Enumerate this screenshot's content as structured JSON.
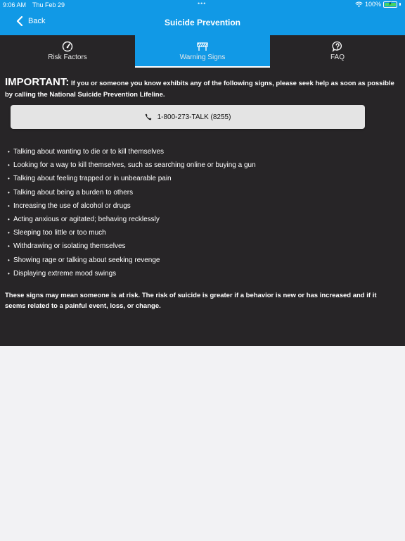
{
  "status_bar": {
    "time": "9:06 AM",
    "date": "Thu Feb 29",
    "battery": "100%",
    "wifi_icon": "wifi-icon",
    "battery_icon": "battery-icon"
  },
  "nav": {
    "back_label": "Back",
    "title": "Suicide Prevention"
  },
  "tabs": [
    {
      "label": "Risk Factors",
      "icon": "gauge-icon",
      "active": false
    },
    {
      "label": "Warning Signs",
      "icon": "barrier-icon",
      "active": true
    },
    {
      "label": "FAQ",
      "icon": "question-bubble-icon",
      "active": false
    }
  ],
  "important": {
    "heading": "IMPORTANT:",
    "text": " If you or someone you know exhibits any of the following signs, please seek help as soon as possible by calling the National Suicide Prevention Lifeline."
  },
  "call_button": {
    "label": "1-800-273-TALK (8255)",
    "icon": "phone-icon"
  },
  "signs": [
    "Talking about wanting to die or to kill themselves",
    "Looking for a way to kill themselves, such as searching online or buying a gun",
    "Talking about feeling trapped or in unbearable pain",
    "Talking about being a burden to others",
    "Increasing the use of alcohol or drugs",
    "Acting anxious or agitated; behaving recklessly",
    "Sleeping too little or too much",
    "Withdrawing or isolating themselves",
    "Showing rage or talking about seeking revenge",
    "Displaying extreme mood swings"
  ],
  "bullet_char": "•",
  "note": "These signs may mean someone is at risk. The risk of suicide is greater if a behavior is new or has increased and if it seems related to a painful event, loss, or change.",
  "colors": {
    "accent": "#1199e6",
    "panel": "#272527",
    "page_bg": "#f2f2f4",
    "button_bg": "#e4e4e4",
    "battery_fill": "#46d466"
  }
}
